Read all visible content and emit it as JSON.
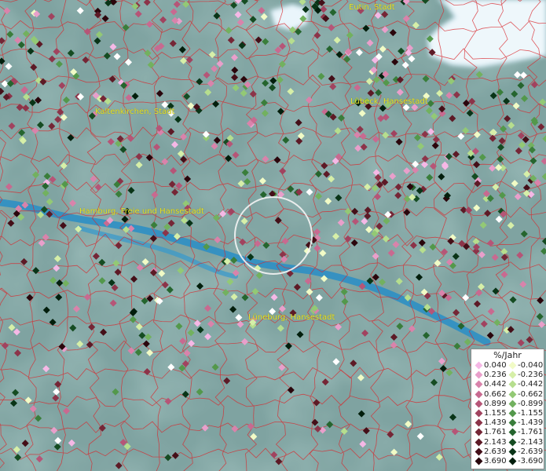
{
  "cities": [
    {
      "name": "Eutin, Stadt"
    },
    {
      "name": "Kaltenkirchen, Stadt"
    },
    {
      "name": "Lübeck, Hansestadt"
    },
    {
      "name": "Hamburg, Freie und Hansestadt"
    },
    {
      "name": "Lüneburg, Hansestadt"
    }
  ],
  "legend": {
    "title": "%/Jahr",
    "positive": [
      {
        "label": "0.040",
        "color": "#f5b8e6"
      },
      {
        "label": "0.236",
        "color": "#e99fcb"
      },
      {
        "label": "0.442",
        "color": "#d983ab"
      },
      {
        "label": "0.662",
        "color": "#c86a90"
      },
      {
        "label": "0.899",
        "color": "#b65577"
      },
      {
        "label": "1.155",
        "color": "#a1435f"
      },
      {
        "label": "1.439",
        "color": "#8c3449"
      },
      {
        "label": "1.761",
        "color": "#752636"
      },
      {
        "label": "2.143",
        "color": "#5d1a26"
      },
      {
        "label": "2.639",
        "color": "#440f18"
      },
      {
        "label": "3.690",
        "color": "#2a060c"
      }
    ],
    "negative": [
      {
        "label": "-0.040",
        "color": "#f1fbc6"
      },
      {
        "label": "-0.236",
        "color": "#d6efa8"
      },
      {
        "label": "-0.442",
        "color": "#b6de8e"
      },
      {
        "label": "-0.662",
        "color": "#93c975"
      },
      {
        "label": "-0.899",
        "color": "#72b15f"
      },
      {
        "label": "-1.155",
        "color": "#53984b"
      },
      {
        "label": "-1.439",
        "color": "#3a7e3b"
      },
      {
        "label": "-1.761",
        "color": "#25652e"
      },
      {
        "label": "-2.143",
        "color": "#154c22"
      },
      {
        "label": "-2.639",
        "color": "#093417"
      },
      {
        "label": "-3.690",
        "color": "#021e0c"
      }
    ]
  },
  "colors": {
    "terrain": "#7fa3a1",
    "water": "#2e8fc4",
    "boundary": "#d9262b",
    "city_label": "#e8e22a",
    "marker_highlight": "#ffffff",
    "selection_ring": "#f4f4f4"
  }
}
